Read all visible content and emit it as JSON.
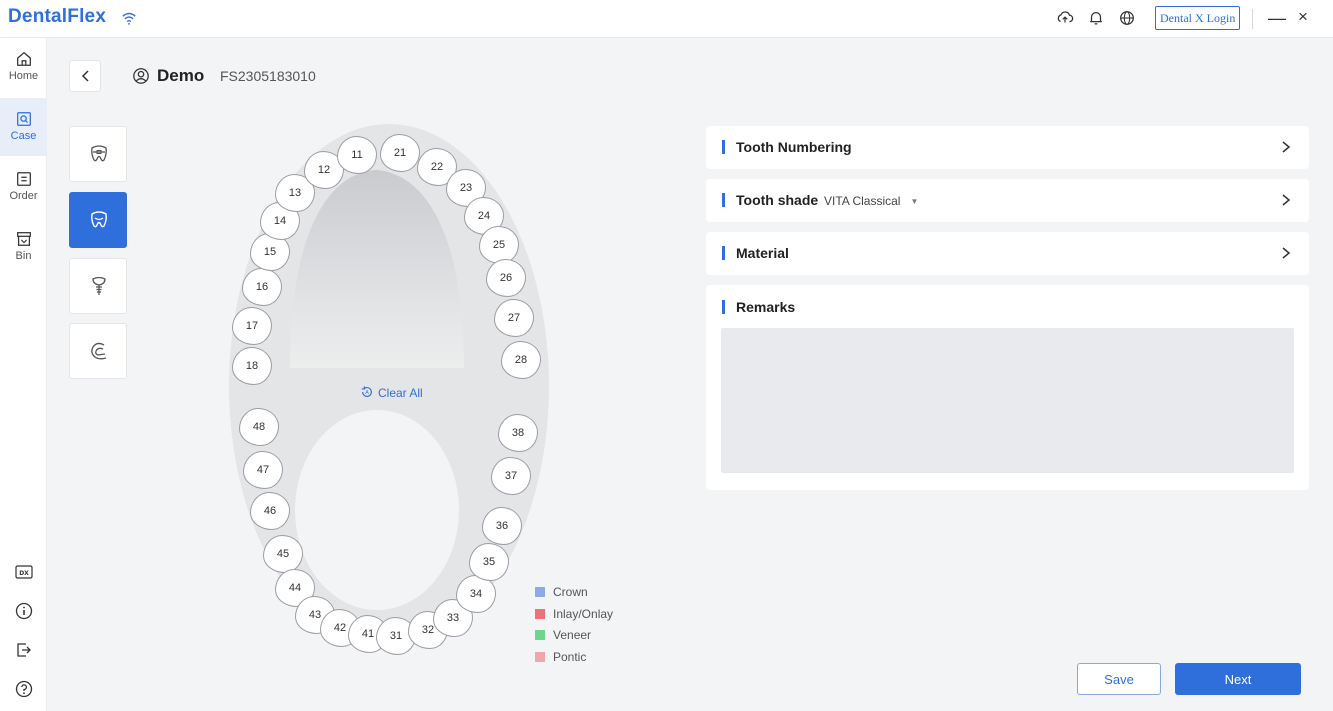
{
  "app": {
    "title": "DentalFlex"
  },
  "titlebar": {
    "icons": [
      "wifi-icon",
      "cloud-sync-icon",
      "bell-icon",
      "globe-icon"
    ],
    "login_label": "Dental X Login",
    "minimize_label": "—",
    "close_label": "×"
  },
  "sidebar": {
    "items": [
      {
        "label": "Home",
        "icon": "home-icon"
      },
      {
        "label": "Case",
        "icon": "case-icon",
        "active": true
      },
      {
        "label": "Order",
        "icon": "order-icon"
      },
      {
        "label": "Bin",
        "icon": "bin-icon"
      }
    ],
    "bottom_icons": [
      "dx-icon",
      "info-icon",
      "logout-icon",
      "help-icon"
    ]
  },
  "header": {
    "patient_name": "Demo",
    "case_id": "FS2305183010"
  },
  "modes": [
    {
      "icon": "tooth-brace-icon",
      "active": false
    },
    {
      "icon": "tooth-icon",
      "active": true
    },
    {
      "icon": "implant-icon",
      "active": false
    },
    {
      "icon": "denture-icon",
      "active": false
    }
  ],
  "chart": {
    "upper_teeth": [
      "18",
      "17",
      "16",
      "15",
      "14",
      "13",
      "12",
      "11",
      "21",
      "22",
      "23",
      "24",
      "25",
      "26",
      "27",
      "28"
    ],
    "lower_teeth": [
      "48",
      "47",
      "46",
      "45",
      "44",
      "43",
      "42",
      "41",
      "31",
      "32",
      "33",
      "34",
      "35",
      "36",
      "37",
      "38"
    ],
    "clear_all_label": "Clear All"
  },
  "legend": [
    {
      "label": "Crown",
      "color": "#8fa8e8"
    },
    {
      "label": "Inlay/Onlay",
      "color": "#e8737a"
    },
    {
      "label": "Veneer",
      "color": "#6dd68a"
    },
    {
      "label": "Pontic",
      "color": "#f0a6aa"
    }
  ],
  "panels": {
    "numbering_title": "Tooth Numbering",
    "shade_title": "Tooth shade",
    "shade_value": "VITA Classical",
    "material_title": "Material",
    "remarks_title": "Remarks",
    "remarks_value": ""
  },
  "actions": {
    "save_label": "Save",
    "next_label": "Next"
  },
  "colors": {
    "accent": "#2f6fdc",
    "background": "#f3f4f6"
  }
}
